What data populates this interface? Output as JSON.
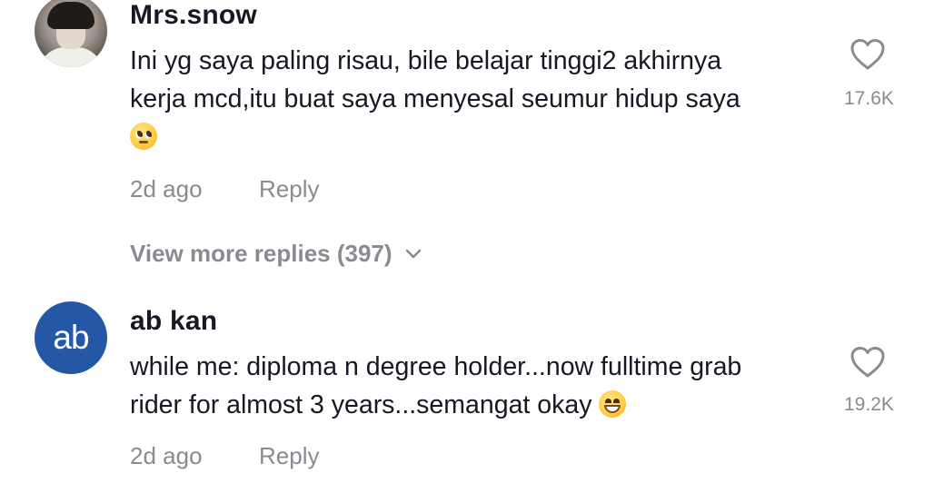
{
  "comments": [
    {
      "username": "Mrs.snow",
      "avatar": "profile-photo",
      "text_lines": [
        "Ini yg saya paling risau, bile belajar tinggi2 akhirnya",
        "kerja mcd,itu buat saya menyesal seumur hidup saya"
      ],
      "emoji": "pleading-face-emoji",
      "time": "2d ago",
      "reply_label": "Reply",
      "like_count": "17.6K",
      "view_more": "View more replies (397)"
    },
    {
      "username": "ab kan",
      "avatar_initials": "ab",
      "text_lines": [
        "while me: diploma n degree holder...now fulltime grab",
        "rider for almost 3 years...semangat okay"
      ],
      "emoji": "grinning-face-emoji",
      "time": "2d ago",
      "reply_label": "Reply",
      "like_count": "19.2K"
    }
  ],
  "colors": {
    "text": "#161823",
    "muted": "#8a8b91",
    "avatar_bg": "#2457a6"
  },
  "icons": [
    "heart-outline-icon",
    "chevron-down-icon"
  ]
}
